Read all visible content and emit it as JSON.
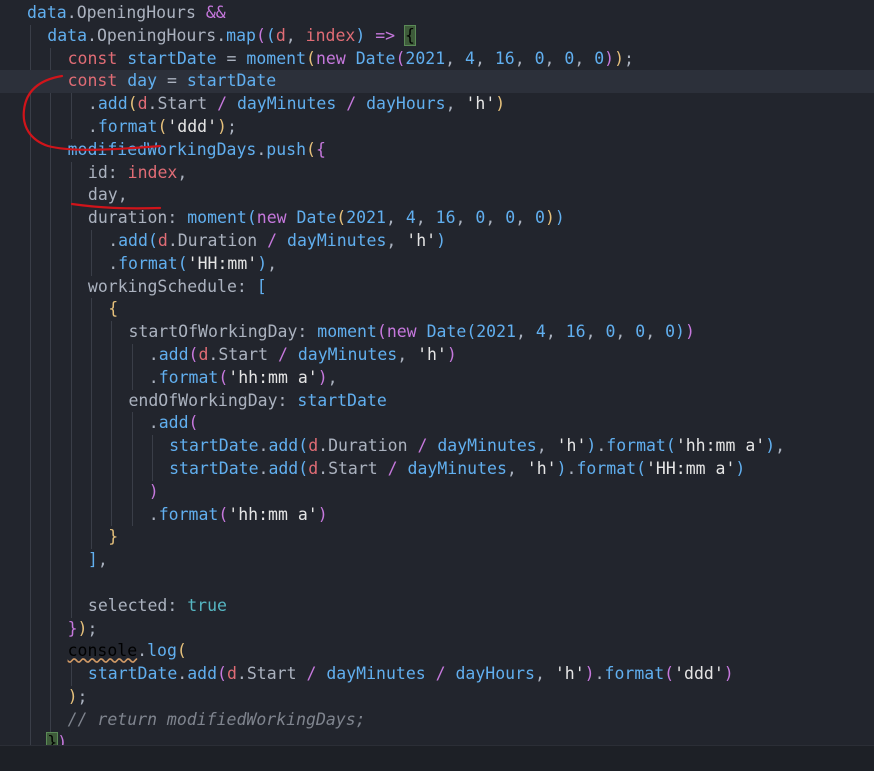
{
  "editor": {
    "lines": [
      {
        "indent": 1,
        "tokens": [
          [
            "var",
            "data"
          ],
          [
            "pun",
            "."
          ],
          [
            "prop",
            "OpeningHours"
          ],
          [
            "pun",
            " "
          ],
          [
            "op",
            "&&"
          ]
        ]
      },
      {
        "indent": 2,
        "tokens": [
          [
            "var",
            "data"
          ],
          [
            "pun",
            "."
          ],
          [
            "prop",
            "OpeningHours"
          ],
          [
            "pun",
            "."
          ],
          [
            "fn",
            "map"
          ],
          [
            "brk2",
            "("
          ],
          [
            "brk3",
            "("
          ],
          [
            "param",
            "d"
          ],
          [
            "pun",
            ", "
          ],
          [
            "param",
            "index"
          ],
          [
            "brk3",
            ")"
          ],
          [
            "pun",
            " "
          ],
          [
            "kw",
            "=>"
          ],
          [
            "pun",
            " "
          ],
          [
            "brkmatch",
            "{"
          ]
        ]
      },
      {
        "indent": 3,
        "tokens": [
          [
            "dec",
            "const"
          ],
          [
            "pun",
            " "
          ],
          [
            "var",
            "startDate"
          ],
          [
            "pun",
            " = "
          ],
          [
            "fn",
            "moment"
          ],
          [
            "brk1",
            "("
          ],
          [
            "kw",
            "new"
          ],
          [
            "pun",
            " "
          ],
          [
            "fn",
            "Date"
          ],
          [
            "brk2",
            "("
          ],
          [
            "num",
            "2021"
          ],
          [
            "pun",
            ", "
          ],
          [
            "num",
            "4"
          ],
          [
            "pun",
            ", "
          ],
          [
            "num",
            "16"
          ],
          [
            "pun",
            ", "
          ],
          [
            "num",
            "0"
          ],
          [
            "pun",
            ", "
          ],
          [
            "num",
            "0"
          ],
          [
            "pun",
            ", "
          ],
          [
            "num",
            "0"
          ],
          [
            "brk2",
            ")"
          ],
          [
            "brk1",
            ")"
          ],
          [
            "pun",
            ";"
          ]
        ]
      },
      {
        "indent": 3,
        "cur": true,
        "tokens": [
          [
            "dec",
            "const"
          ],
          [
            "pun",
            " "
          ],
          [
            "var",
            "day"
          ],
          [
            "pun",
            " = "
          ],
          [
            "var",
            "startDate"
          ]
        ]
      },
      {
        "indent": 4,
        "tokens": [
          [
            "pun",
            "."
          ],
          [
            "fn",
            "add"
          ],
          [
            "brk1",
            "("
          ],
          [
            "param",
            "d"
          ],
          [
            "pun",
            "."
          ],
          [
            "prop",
            "Start"
          ],
          [
            "pun",
            " "
          ],
          [
            "op",
            "/"
          ],
          [
            "pun",
            " "
          ],
          [
            "var",
            "dayMinutes"
          ],
          [
            "pun",
            " "
          ],
          [
            "op",
            "/"
          ],
          [
            "pun",
            " "
          ],
          [
            "var",
            "dayHours"
          ],
          [
            "pun",
            ", "
          ],
          [
            "str",
            "'h'"
          ],
          [
            "brk1",
            ")"
          ]
        ]
      },
      {
        "indent": 4,
        "tokens": [
          [
            "pun",
            "."
          ],
          [
            "fn",
            "format"
          ],
          [
            "brk1",
            "("
          ],
          [
            "str",
            "'ddd'"
          ],
          [
            "brk1",
            ")"
          ],
          [
            "pun",
            ";"
          ]
        ]
      },
      {
        "indent": 3,
        "tokens": [
          [
            "var",
            "modifiedWorkingDays"
          ],
          [
            "pun",
            "."
          ],
          [
            "fn",
            "push"
          ],
          [
            "brk1",
            "("
          ],
          [
            "brk2",
            "{"
          ]
        ]
      },
      {
        "indent": 4,
        "tokens": [
          [
            "prop",
            "id"
          ],
          [
            "pun",
            ": "
          ],
          [
            "param",
            "index"
          ],
          [
            "pun",
            ","
          ]
        ]
      },
      {
        "indent": 4,
        "tokens": [
          [
            "prop",
            "day"
          ],
          [
            "pun",
            ","
          ]
        ]
      },
      {
        "indent": 4,
        "tokens": [
          [
            "prop",
            "duration"
          ],
          [
            "pun",
            ": "
          ],
          [
            "fn",
            "moment"
          ],
          [
            "brk3",
            "("
          ],
          [
            "kw",
            "new"
          ],
          [
            "pun",
            " "
          ],
          [
            "fn",
            "Date"
          ],
          [
            "brk1",
            "("
          ],
          [
            "num",
            "2021"
          ],
          [
            "pun",
            ", "
          ],
          [
            "num",
            "4"
          ],
          [
            "pun",
            ", "
          ],
          [
            "num",
            "16"
          ],
          [
            "pun",
            ", "
          ],
          [
            "num",
            "0"
          ],
          [
            "pun",
            ", "
          ],
          [
            "num",
            "0"
          ],
          [
            "pun",
            ", "
          ],
          [
            "num",
            "0"
          ],
          [
            "brk1",
            ")"
          ],
          [
            "brk3",
            ")"
          ]
        ]
      },
      {
        "indent": 5,
        "tokens": [
          [
            "pun",
            "."
          ],
          [
            "fn",
            "add"
          ],
          [
            "brk3",
            "("
          ],
          [
            "param",
            "d"
          ],
          [
            "pun",
            "."
          ],
          [
            "prop",
            "Duration"
          ],
          [
            "pun",
            " "
          ],
          [
            "op",
            "/"
          ],
          [
            "pun",
            " "
          ],
          [
            "var",
            "dayMinutes"
          ],
          [
            "pun",
            ", "
          ],
          [
            "str",
            "'h'"
          ],
          [
            "brk3",
            ")"
          ]
        ]
      },
      {
        "indent": 5,
        "tokens": [
          [
            "pun",
            "."
          ],
          [
            "fn",
            "format"
          ],
          [
            "brk3",
            "("
          ],
          [
            "str",
            "'HH:mm'"
          ],
          [
            "brk3",
            ")"
          ],
          [
            "pun",
            ","
          ]
        ]
      },
      {
        "indent": 4,
        "tokens": [
          [
            "prop",
            "workingSchedule"
          ],
          [
            "pun",
            ": "
          ],
          [
            "brk3",
            "["
          ]
        ]
      },
      {
        "indent": 5,
        "tokens": [
          [
            "brk1",
            "{"
          ]
        ]
      },
      {
        "indent": 6,
        "tokens": [
          [
            "prop",
            "startOfWorkingDay"
          ],
          [
            "pun",
            ": "
          ],
          [
            "fn",
            "moment"
          ],
          [
            "brk2",
            "("
          ],
          [
            "kw",
            "new"
          ],
          [
            "pun",
            " "
          ],
          [
            "fn",
            "Date"
          ],
          [
            "brk3",
            "("
          ],
          [
            "num",
            "2021"
          ],
          [
            "pun",
            ", "
          ],
          [
            "num",
            "4"
          ],
          [
            "pun",
            ", "
          ],
          [
            "num",
            "16"
          ],
          [
            "pun",
            ", "
          ],
          [
            "num",
            "0"
          ],
          [
            "pun",
            ", "
          ],
          [
            "num",
            "0"
          ],
          [
            "pun",
            ", "
          ],
          [
            "num",
            "0"
          ],
          [
            "brk3",
            ")"
          ],
          [
            "brk2",
            ")"
          ]
        ]
      },
      {
        "indent": 7,
        "tokens": [
          [
            "pun",
            "."
          ],
          [
            "fn",
            "add"
          ],
          [
            "brk2",
            "("
          ],
          [
            "param",
            "d"
          ],
          [
            "pun",
            "."
          ],
          [
            "prop",
            "Start"
          ],
          [
            "pun",
            " "
          ],
          [
            "op",
            "/"
          ],
          [
            "pun",
            " "
          ],
          [
            "var",
            "dayMinutes"
          ],
          [
            "pun",
            ", "
          ],
          [
            "str",
            "'h'"
          ],
          [
            "brk2",
            ")"
          ]
        ]
      },
      {
        "indent": 7,
        "tokens": [
          [
            "pun",
            "."
          ],
          [
            "fn",
            "format"
          ],
          [
            "brk2",
            "("
          ],
          [
            "str",
            "'hh:mm a'"
          ],
          [
            "brk2",
            ")"
          ],
          [
            "pun",
            ","
          ]
        ]
      },
      {
        "indent": 6,
        "tokens": [
          [
            "prop",
            "endOfWorkingDay"
          ],
          [
            "pun",
            ": "
          ],
          [
            "var",
            "startDate"
          ]
        ]
      },
      {
        "indent": 7,
        "tokens": [
          [
            "pun",
            "."
          ],
          [
            "fn",
            "add"
          ],
          [
            "brk2",
            "("
          ]
        ]
      },
      {
        "indent": 8,
        "tokens": [
          [
            "var",
            "startDate"
          ],
          [
            "pun",
            "."
          ],
          [
            "fn",
            "add"
          ],
          [
            "brk3",
            "("
          ],
          [
            "param",
            "d"
          ],
          [
            "pun",
            "."
          ],
          [
            "prop",
            "Duration"
          ],
          [
            "pun",
            " "
          ],
          [
            "op",
            "/"
          ],
          [
            "pun",
            " "
          ],
          [
            "var",
            "dayMinutes"
          ],
          [
            "pun",
            ", "
          ],
          [
            "str",
            "'h'"
          ],
          [
            "brk3",
            ")"
          ],
          [
            "pun",
            "."
          ],
          [
            "fn",
            "format"
          ],
          [
            "brk3",
            "("
          ],
          [
            "str",
            "'hh:mm a'"
          ],
          [
            "brk3",
            ")"
          ],
          [
            "pun",
            ","
          ]
        ]
      },
      {
        "indent": 8,
        "tokens": [
          [
            "var",
            "startDate"
          ],
          [
            "pun",
            "."
          ],
          [
            "fn",
            "add"
          ],
          [
            "brk3",
            "("
          ],
          [
            "param",
            "d"
          ],
          [
            "pun",
            "."
          ],
          [
            "prop",
            "Start"
          ],
          [
            "pun",
            " "
          ],
          [
            "op",
            "/"
          ],
          [
            "pun",
            " "
          ],
          [
            "var",
            "dayMinutes"
          ],
          [
            "pun",
            ", "
          ],
          [
            "str",
            "'h'"
          ],
          [
            "brk3",
            ")"
          ],
          [
            "pun",
            "."
          ],
          [
            "fn",
            "format"
          ],
          [
            "brk3",
            "("
          ],
          [
            "str",
            "'HH:mm a'"
          ],
          [
            "brk3",
            ")"
          ]
        ]
      },
      {
        "indent": 7,
        "tokens": [
          [
            "brk2",
            ")"
          ]
        ]
      },
      {
        "indent": 7,
        "tokens": [
          [
            "pun",
            "."
          ],
          [
            "fn",
            "format"
          ],
          [
            "brk2",
            "("
          ],
          [
            "str",
            "'hh:mm a'"
          ],
          [
            "brk2",
            ")"
          ]
        ]
      },
      {
        "indent": 5,
        "tokens": [
          [
            "brk1",
            "}"
          ]
        ]
      },
      {
        "indent": 4,
        "tokens": [
          [
            "brk3",
            "]"
          ],
          [
            "pun",
            ","
          ]
        ]
      },
      {
        "indent": 4,
        "tokens": []
      },
      {
        "indent": 4,
        "tokens": [
          [
            "prop",
            "selected"
          ],
          [
            "pun",
            ": "
          ],
          [
            "bool",
            "true"
          ]
        ]
      },
      {
        "indent": 3,
        "tokens": [
          [
            "brk2",
            "}"
          ],
          [
            "brk1",
            ")"
          ],
          [
            "pun",
            ";"
          ]
        ]
      },
      {
        "indent": 3,
        "tokens": [
          [
            "warn",
            "console"
          ],
          [
            "pun",
            "."
          ],
          [
            "fn",
            "log"
          ],
          [
            "brk1",
            "("
          ]
        ]
      },
      {
        "indent": 4,
        "tokens": [
          [
            "var",
            "startDate"
          ],
          [
            "pun",
            "."
          ],
          [
            "fn",
            "add"
          ],
          [
            "brk2",
            "("
          ],
          [
            "param",
            "d"
          ],
          [
            "pun",
            "."
          ],
          [
            "prop",
            "Start"
          ],
          [
            "pun",
            " "
          ],
          [
            "op",
            "/"
          ],
          [
            "pun",
            " "
          ],
          [
            "var",
            "dayMinutes"
          ],
          [
            "pun",
            " "
          ],
          [
            "op",
            "/"
          ],
          [
            "pun",
            " "
          ],
          [
            "var",
            "dayHours"
          ],
          [
            "pun",
            ", "
          ],
          [
            "str",
            "'h'"
          ],
          [
            "brk2",
            ")"
          ],
          [
            "pun",
            "."
          ],
          [
            "fn",
            "format"
          ],
          [
            "brk2",
            "("
          ],
          [
            "str",
            "'ddd'"
          ],
          [
            "brk2",
            ")"
          ]
        ]
      },
      {
        "indent": 3,
        "tokens": [
          [
            "brk1",
            ")"
          ],
          [
            "pun",
            ";"
          ]
        ]
      },
      {
        "indent": 3,
        "tokens": [
          [
            "cm",
            "// return modifiedWorkingDays;"
          ]
        ]
      },
      {
        "indent": 2,
        "tokens": [
          [
            "brkmatch",
            "}"
          ],
          [
            "brk2",
            ")"
          ],
          [
            "pun",
            "."
          ]
        ]
      }
    ]
  },
  "colors": {
    "background": "#22252d",
    "annotation": "#d0141a"
  }
}
